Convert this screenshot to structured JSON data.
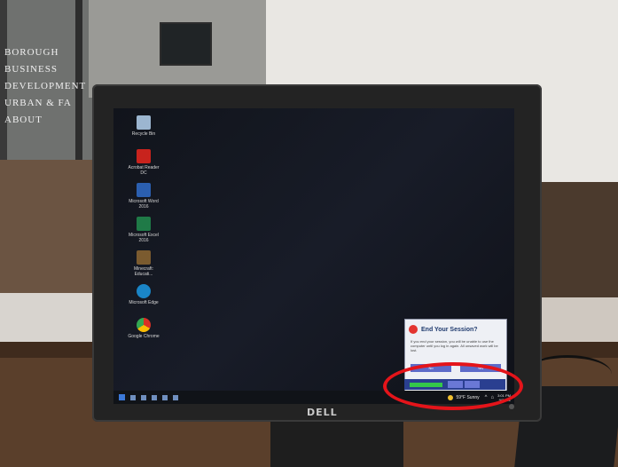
{
  "background_sign": [
    "BOROUGH",
    "BUSINESS",
    "DEVELOPMENT",
    "URBAN & FA",
    "ABOUT"
  ],
  "monitor_brand": "DELL",
  "desktop_icons": [
    {
      "label": "Recycle Bin",
      "icon": "recycle-bin-icon"
    },
    {
      "label": "Acrobat Reader DC",
      "icon": "acrobat-icon"
    },
    {
      "label": "Microsoft Word 2016",
      "icon": "word-icon"
    },
    {
      "label": "Microsoft Excel 2016",
      "icon": "excel-icon"
    },
    {
      "label": "Minecraft: Educati...",
      "icon": "minecraft-icon"
    },
    {
      "label": "Microsoft Edge",
      "icon": "edge-icon"
    },
    {
      "label": "Google Chrome",
      "icon": "chrome-icon"
    }
  ],
  "dialog": {
    "title": "End Your Session?",
    "body": "If you end your session, you will be unable to use the computer until you log in again. All unsaved work will be lost.",
    "buttons": [
      "No",
      "Yes"
    ]
  },
  "session_bar": {
    "progress": 0.62
  },
  "taskbar": {
    "weather": "59°F Sunny",
    "time": "3:01 PM",
    "date": "9/22/21"
  },
  "colors": {
    "annotation": "#e4141a",
    "dialog_accent": "#2a3f90",
    "progress": "#34c84a"
  }
}
